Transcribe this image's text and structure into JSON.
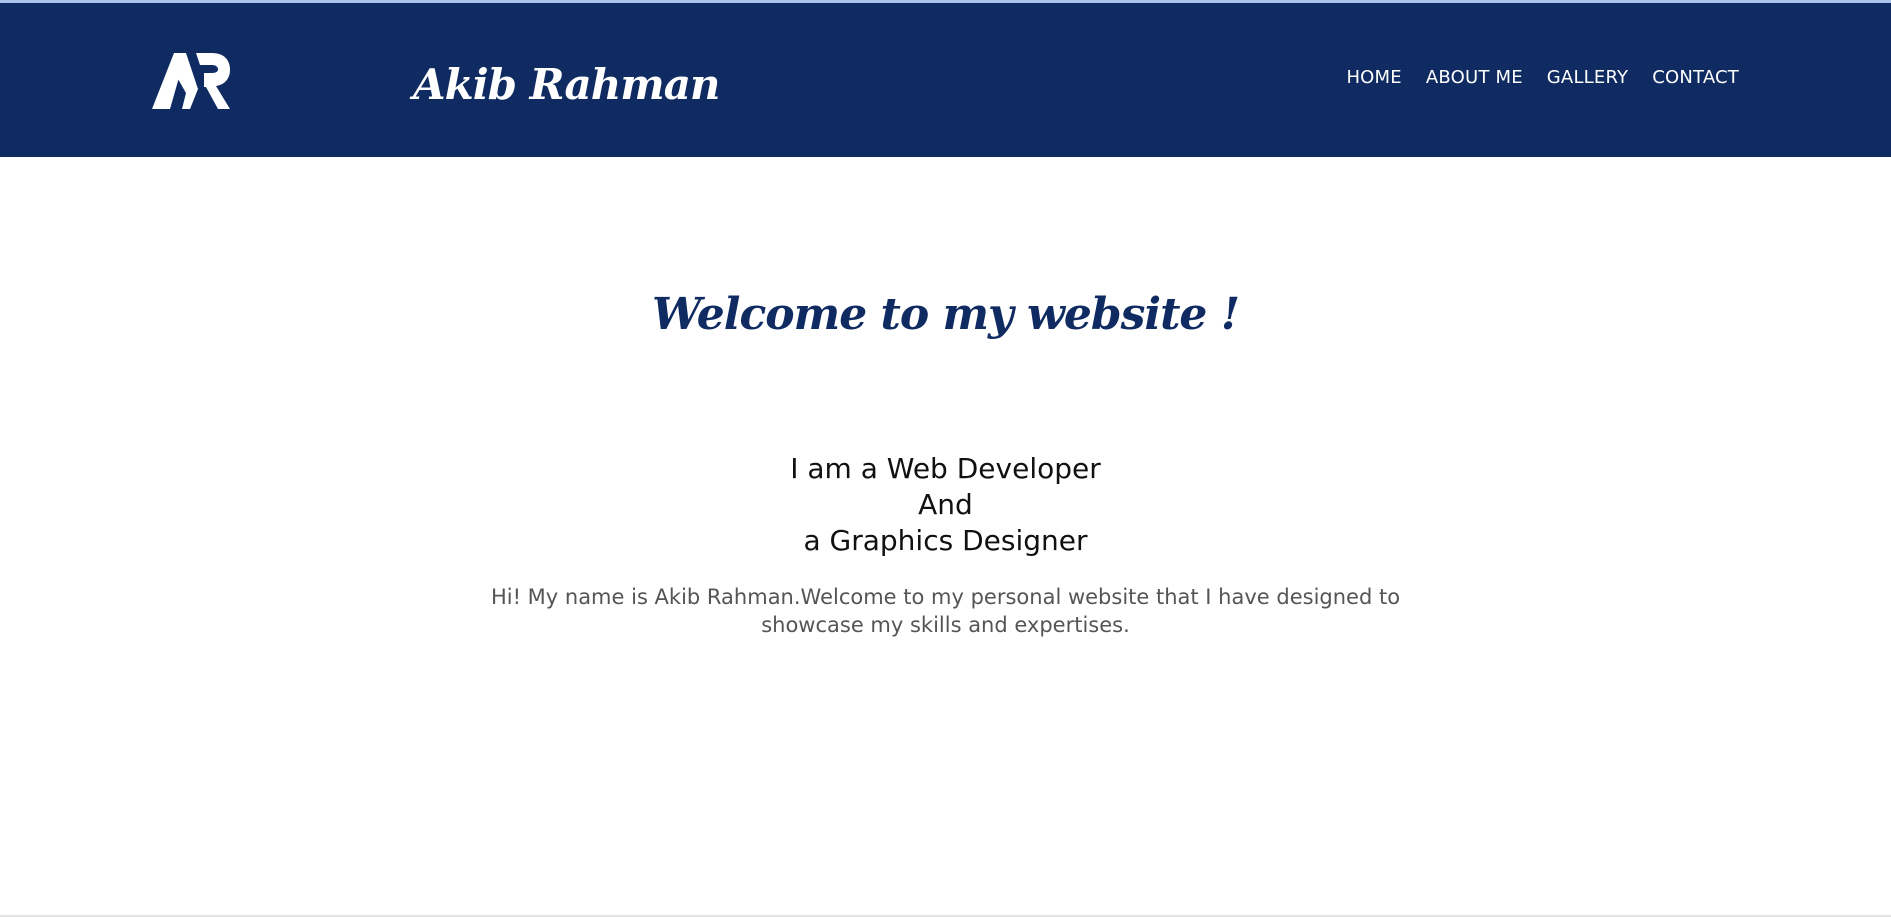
{
  "header": {
    "logo_text": "AR",
    "brand_name": "Akib Rahman",
    "nav": [
      {
        "label": "HOME"
      },
      {
        "label": "ABOUT ME"
      },
      {
        "label": "GALLERY"
      },
      {
        "label": "CONTACT"
      }
    ],
    "background_color": "#0f2b62"
  },
  "hero": {
    "welcome_text": "Welcome to my website !",
    "role_line_1": "I am a Web Developer",
    "role_line_2": "And",
    "role_line_3": "a Graphics Designer",
    "intro_text": "Hi! My name is Akib Rahman.Welcome to my personal website that I have designed to showcase my skills and expertises."
  }
}
